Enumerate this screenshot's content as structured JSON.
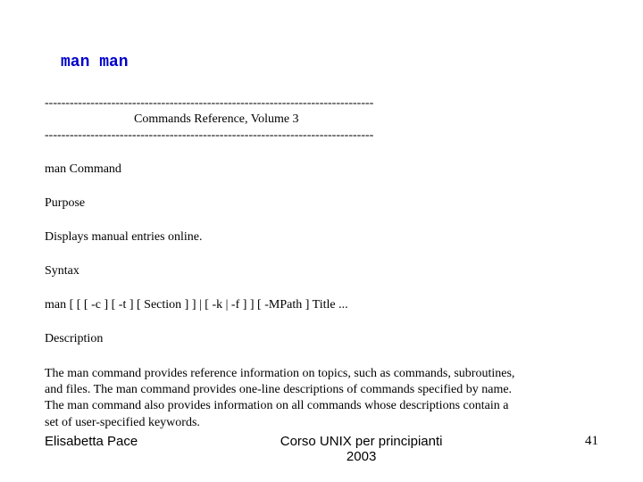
{
  "title": "man man",
  "divider": "-------------------------------------------------------------------------------",
  "reference_heading": "Commands Reference, Volume 3",
  "command_name": "man Command",
  "purpose_label": "Purpose",
  "purpose_text": "Displays manual entries online.",
  "syntax_label": "Syntax",
  "syntax_text": "man [ [ [ -c ] [ -t ] [ Section ] ] | [ -k | -f ] ] [ -MPath ] Title ...",
  "description_label": "Description",
  "description_text": "The man command provides reference information on topics, such as commands, subroutines, and files. The man command provides one-line descriptions of commands specified by name. The man command also provides information on all commands whose descriptions contain a set of user-specified keywords.",
  "footer": {
    "author": "Elisabetta Pace",
    "course_line1": "Corso UNIX per principianti",
    "course_line2": "2003",
    "page_number": "41"
  }
}
